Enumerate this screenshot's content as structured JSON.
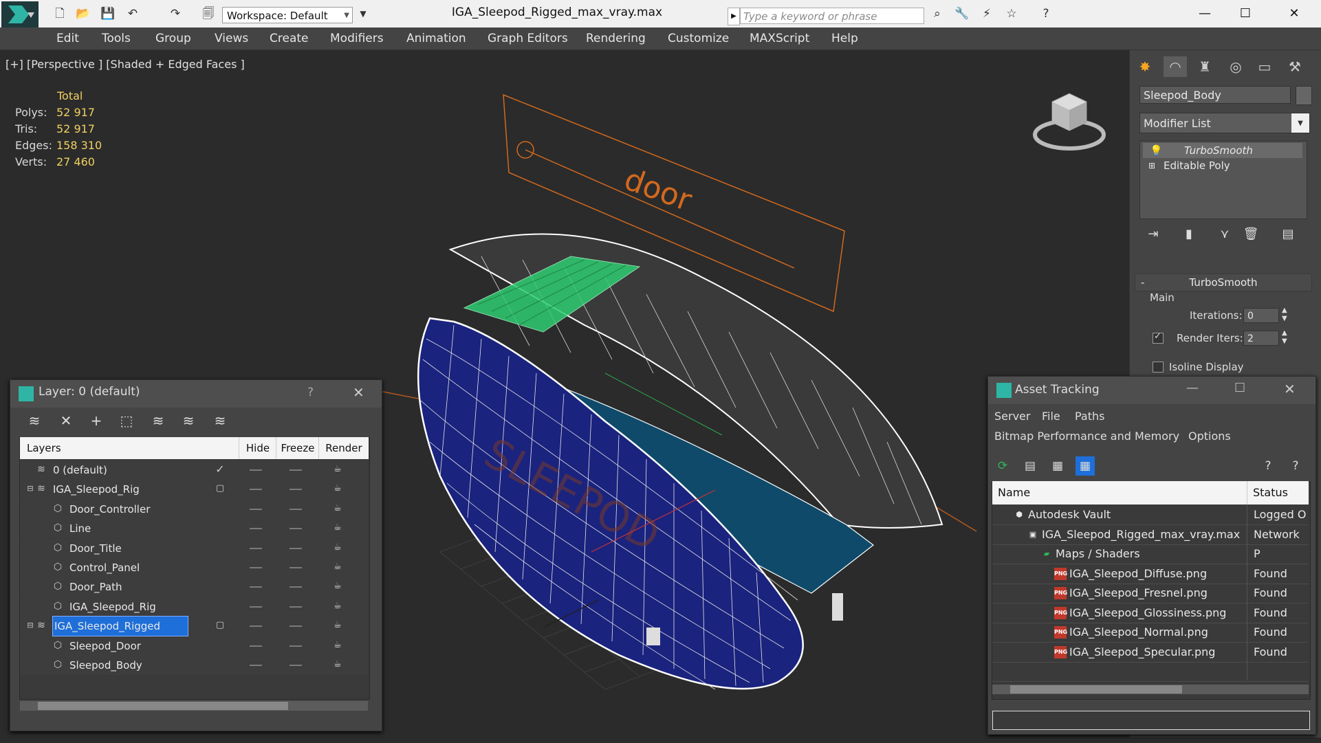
{
  "titlebar": {
    "workspace_label": "Workspace: Default",
    "window_title": "IGA_Sleepod_Rigged_max_vray.max",
    "search_placeholder": "Type a keyword or phrase"
  },
  "menu": [
    "Edit",
    "Tools",
    "Group",
    "Views",
    "Create",
    "Modifiers",
    "Animation",
    "Graph Editors",
    "Rendering",
    "Customize",
    "MAXScript",
    "Help"
  ],
  "viewport": {
    "label": "[+] [Perspective ] [Shaded + Edged Faces ]",
    "stats_header": "Total",
    "stats": [
      {
        "label": "Polys:",
        "value": "52 917"
      },
      {
        "label": "Tris:",
        "value": "52 917"
      },
      {
        "label": "Edges:",
        "value": "158 310"
      },
      {
        "label": "Verts:",
        "value": "27 460"
      }
    ],
    "door_text": "door",
    "pod_text": "SLEEPOD"
  },
  "command_panel": {
    "object_name": "Sleepod_Body",
    "modifier_list": "Modifier List",
    "stack": [
      "TurboSmooth",
      "Editable Poly"
    ],
    "rollout_title": "TurboSmooth",
    "group_main": "Main",
    "iterations_label": "Iterations:",
    "iterations_value": "0",
    "render_iters_label": "Render Iters:",
    "render_iters_value": "2",
    "isoline_label": "Isoline Display"
  },
  "layer_dialog": {
    "title": "Layer: 0 (default)",
    "help": "?",
    "columns": {
      "layers": "Layers",
      "hide": "Hide",
      "freeze": "Freeze",
      "render": "Render"
    },
    "rows": [
      {
        "name": "0 (default)",
        "level": 0
      },
      {
        "name": "IGA_Sleepod_Rig",
        "level": 0
      },
      {
        "name": "Door_Controller",
        "level": 1
      },
      {
        "name": "Line",
        "level": 1
      },
      {
        "name": "Door_Title",
        "level": 1
      },
      {
        "name": "Control_Panel",
        "level": 1
      },
      {
        "name": "Door_Path",
        "level": 1
      },
      {
        "name": "IGA_Sleepod_Rig",
        "level": 1
      },
      {
        "name": "IGA_Sleepod_Rigged",
        "level": 0
      },
      {
        "name": "Sleepod_Door",
        "level": 1
      },
      {
        "name": "Sleepod_Body",
        "level": 1
      }
    ]
  },
  "asset_dialog": {
    "title": "Asset Tracking",
    "menu": [
      "Server",
      "File",
      "Paths",
      "Bitmap Performance and Memory",
      "Options"
    ],
    "columns": {
      "name": "Name",
      "status": "Status"
    },
    "rows": [
      {
        "name": "Autodesk Vault",
        "status": "Logged O"
      },
      {
        "name": "IGA_Sleepod_Rigged_max_vray.max",
        "status": "Network P"
      },
      {
        "name": "Maps / Shaders",
        "status": ""
      },
      {
        "name": "IGA_Sleepod_Diffuse.png",
        "status": "Found"
      },
      {
        "name": "IGA_Sleepod_Fresnel.png",
        "status": "Found"
      },
      {
        "name": "IGA_Sleepod_Glossiness.png",
        "status": "Found"
      },
      {
        "name": "IGA_Sleepod_Normal.png",
        "status": "Found"
      },
      {
        "name": "IGA_Sleepod_Specular.png",
        "status": "Found"
      }
    ]
  },
  "colors": {
    "accent": "#1e6fd9",
    "stats": "#f0d060",
    "wire": "#ffffff",
    "pod": "#1a237e",
    "orange": "#d2691e"
  }
}
